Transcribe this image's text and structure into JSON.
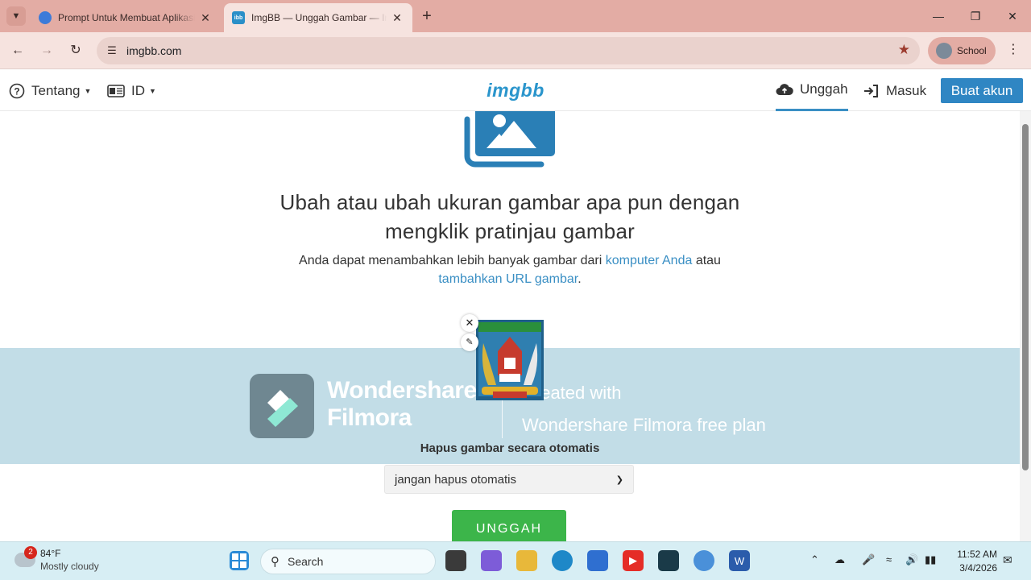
{
  "browser": {
    "tabs": [
      {
        "title": "Prompt Untuk Membuat Aplikasi",
        "active": false
      },
      {
        "title": "ImgBB — Unggah Gambar — ImgBB",
        "active": true
      }
    ],
    "url": "imgbb.com",
    "profile_label": "School"
  },
  "header": {
    "about_label": "Tentang",
    "language_label": "ID",
    "logo_text": "imgbb",
    "upload_label": "Unggah",
    "login_label": "Masuk",
    "create_account_label": "Buat akun"
  },
  "main": {
    "headline_line1": "Ubah atau ubah ukuran gambar apa pun dengan",
    "headline_line2": "mengklik pratinjau gambar",
    "sub_text_prefix": "Anda dapat menambahkan lebih banyak gambar dari",
    "sub_link_computer": "komputer Anda",
    "sub_text_mid": "atau",
    "sub_link_url": "tambahkan URL gambar",
    "sub_text_suffix": ".",
    "auto_delete_label": "Hapus gambar secara otomatis",
    "auto_delete_value": "jangan hapus otomatis",
    "upload_button": "UNGGAH"
  },
  "watermark": {
    "brand_line1": "Wondershare",
    "brand_line2": "Filmora",
    "note_line1": "Created with",
    "note_line2": "Wondershare Filmora free plan"
  },
  "taskbar": {
    "weather_temp": "84°F",
    "weather_desc": "Mostly cloudy",
    "weather_badge": "2",
    "search_placeholder": "Search",
    "time": "11:52 AM",
    "date": "3/4/2026"
  },
  "colors": {
    "accent": "#2f86c3",
    "link": "#3a8fc4",
    "upload_green": "#3cb54a",
    "tab_bar": "#e3aca4",
    "watermark_band": "#c2dde7"
  }
}
